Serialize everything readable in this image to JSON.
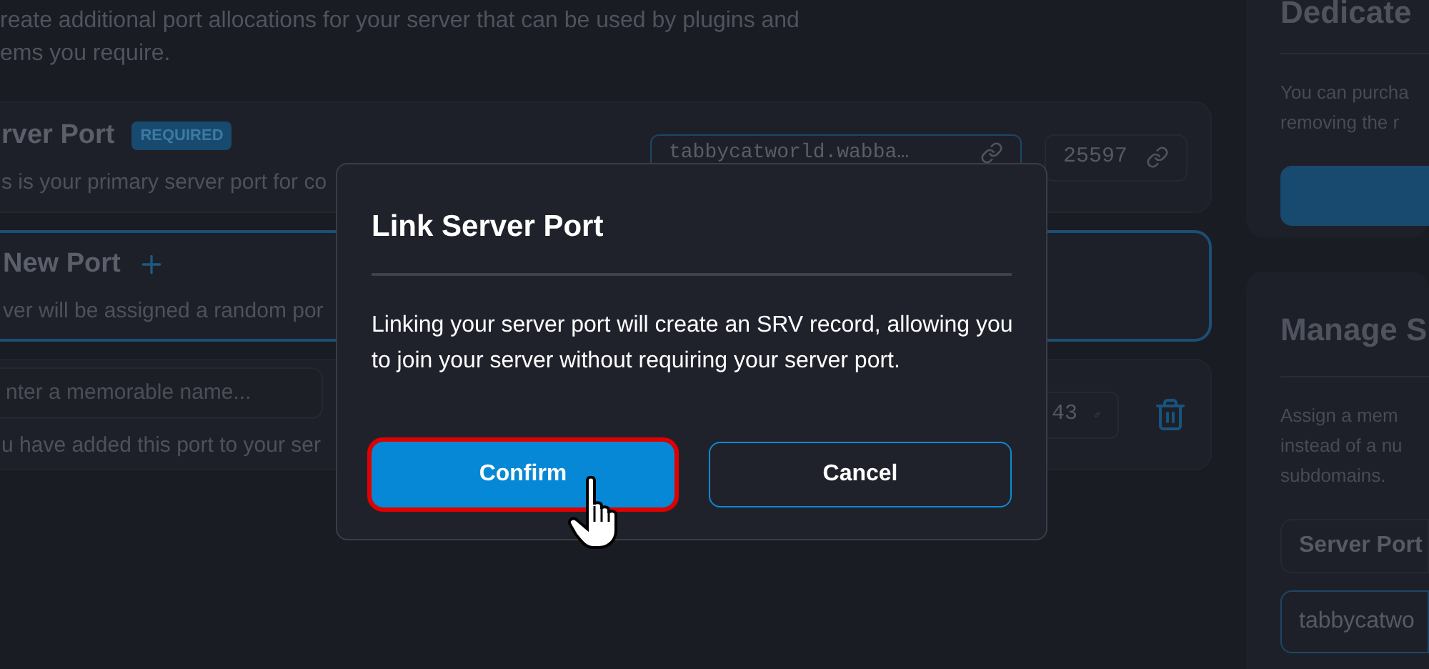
{
  "intro_lines": [
    "reate additional port allocations for your server that can be used by plugins and",
    "ems you require."
  ],
  "ports": [
    {
      "kind": "primary",
      "title": "rver Port",
      "badge": "REQUIRED",
      "description": "s is your primary server port for co",
      "address": "tabbycatworld.wabba…",
      "port": "25597"
    },
    {
      "kind": "new",
      "title": "New Port",
      "description": "ver will be assigned a random por"
    },
    {
      "kind": "custom",
      "placeholder": "nter a memorable name...",
      "description": "u have added this port to your ser",
      "port": "43"
    }
  ],
  "dedicated": {
    "title": "Dedicate",
    "lines": [
      "You can purcha",
      "removing the r"
    ]
  },
  "manage": {
    "title": "Manage S",
    "lines": [
      "Assign a mem",
      "instead of a nu",
      "subdomains."
    ],
    "field_label": "Server Port",
    "field_value": "tabbycatwo"
  },
  "dialog": {
    "title": "Link Server Port",
    "message": "Linking your server port will create an SRV record, allowing you to join your server without requiring your server port.",
    "buttons": [
      {
        "label": "Confirm",
        "kind": "primary",
        "highlighted": true
      },
      {
        "label": "Cancel",
        "kind": "secondary",
        "highlighted": false
      }
    ]
  }
}
